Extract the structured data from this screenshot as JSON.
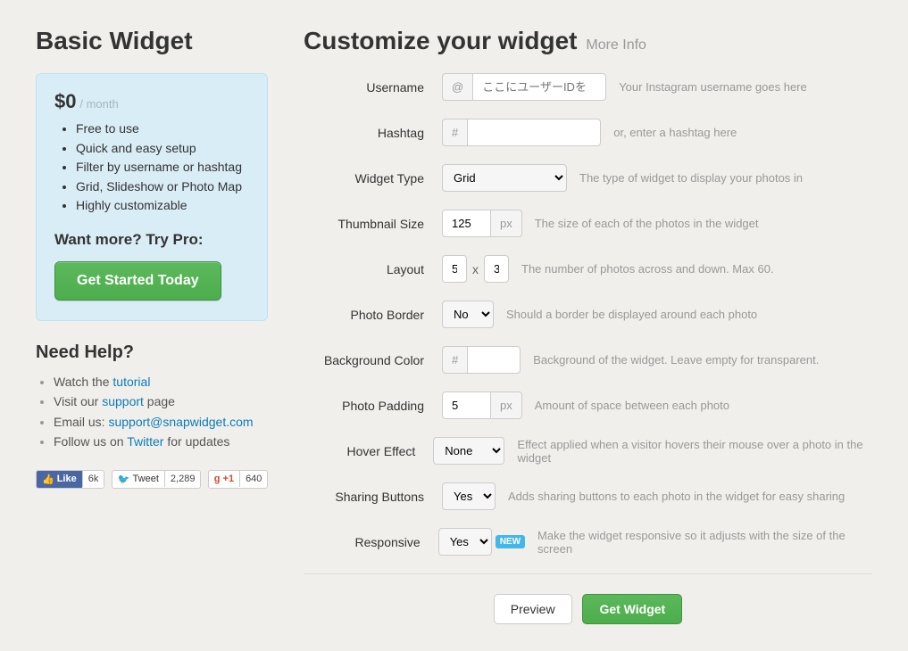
{
  "sidebar": {
    "title": "Basic Widget",
    "price": "$0",
    "per": "/ month",
    "features": [
      "Free to use",
      "Quick and easy setup",
      "Filter by username or hashtag",
      "Grid, Slideshow or Photo Map",
      "Highly customizable"
    ],
    "wantmore": "Want more? Try Pro:",
    "cta": "Get Started Today",
    "help_heading": "Need Help?",
    "help": {
      "watch_pre": "Watch the ",
      "watch_link": "tutorial",
      "visit_pre": "Visit our ",
      "visit_link": "support",
      "visit_post": " page",
      "email_pre": "Email us: ",
      "email_link": "support@snapwidget.com",
      "follow_pre": "Follow us on ",
      "follow_link": "Twitter",
      "follow_post": " for updates"
    },
    "social": {
      "fb_label": "Like",
      "fb_count": "6k",
      "tw_label": "Tweet",
      "tw_count": "2,289",
      "gp_label": "+1",
      "gp_count": "640"
    }
  },
  "form": {
    "heading": "Customize your widget",
    "moreinfo": "More Info",
    "username": {
      "label": "Username",
      "prefix": "@",
      "placeholder": "ここにユーザーIDを",
      "hint": "Your Instagram username goes here"
    },
    "hashtag": {
      "label": "Hashtag",
      "prefix": "#",
      "placeholder": "",
      "hint": "or, enter a hashtag here"
    },
    "widget_type": {
      "label": "Widget Type",
      "value": "Grid",
      "hint": "The type of widget to display your photos in"
    },
    "thumbnail": {
      "label": "Thumbnail Size",
      "value": "125",
      "suffix": "px",
      "hint": "The size of each of the photos in the widget"
    },
    "layout": {
      "label": "Layout",
      "cols": "5",
      "rows": "3",
      "x": "x",
      "hint": "The number of photos across and down. Max 60."
    },
    "border": {
      "label": "Photo Border",
      "value": "No",
      "hint": "Should a border be displayed around each photo"
    },
    "bg": {
      "label": "Background Color",
      "prefix": "#",
      "value": "",
      "hint": "Background of the widget. Leave empty for transparent."
    },
    "padding": {
      "label": "Photo Padding",
      "value": "5",
      "suffix": "px",
      "hint": "Amount of space between each photo"
    },
    "hover": {
      "label": "Hover Effect",
      "value": "None",
      "hint": "Effect applied when a visitor hovers their mouse over a photo in the widget"
    },
    "sharing": {
      "label": "Sharing Buttons",
      "value": "Yes",
      "hint": "Adds sharing buttons to each photo in the widget for easy sharing"
    },
    "responsive": {
      "label": "Responsive",
      "value": "Yes",
      "badge": "NEW",
      "hint": "Make the widget responsive so it adjusts with the size of the screen"
    },
    "preview_btn": "Preview",
    "submit_btn": "Get Widget"
  }
}
